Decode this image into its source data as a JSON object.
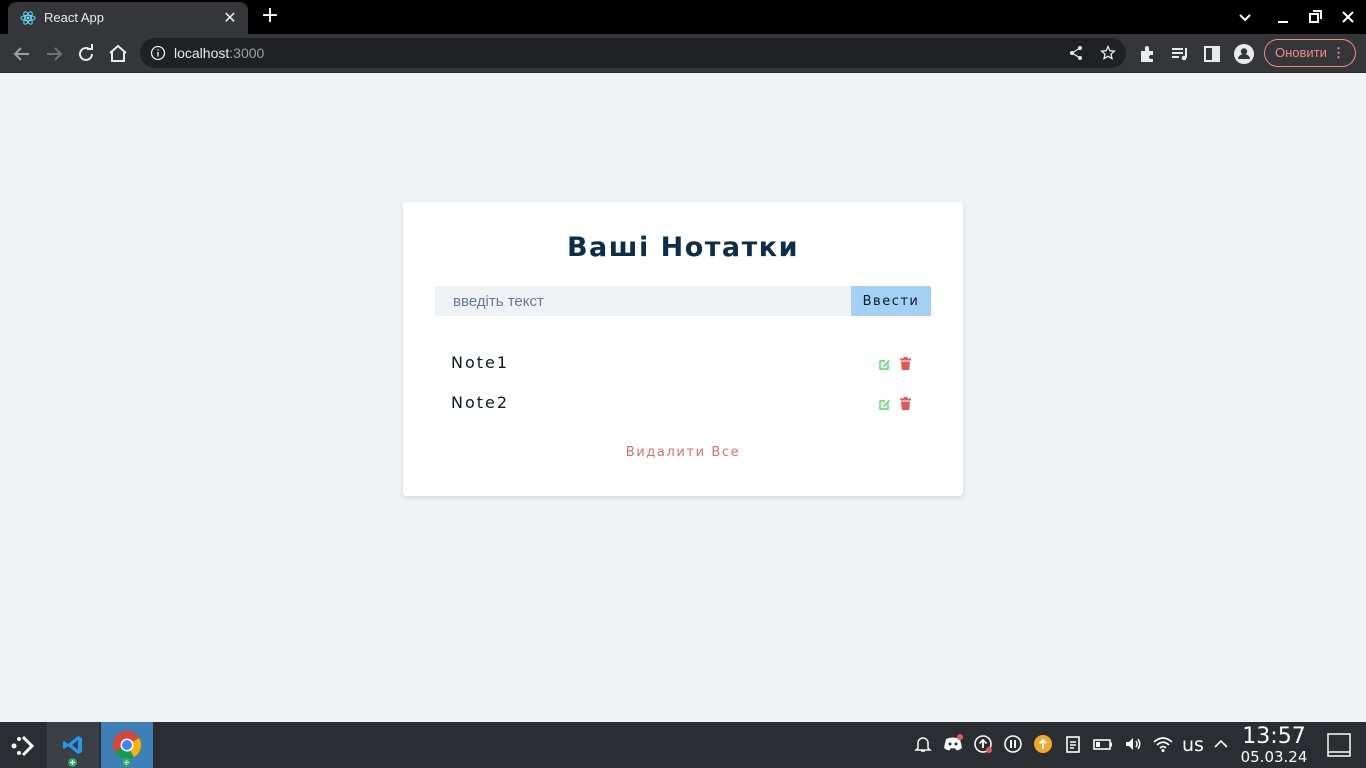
{
  "browser": {
    "tab_title": "React App",
    "tab_favicon": "react-logo-icon",
    "url_host": "localhost",
    "url_port": ":3000",
    "update_button_label": "Оновити"
  },
  "page": {
    "heading": "Ваші Нотатки",
    "input_placeholder": "введіть текст",
    "input_value": "",
    "submit_label": "Ввести",
    "notes": [
      {
        "text": "Note1"
      },
      {
        "text": "Note2"
      }
    ],
    "clear_all_label": "Видалити Все",
    "colors": {
      "heading": "#0b2e4a",
      "submit_bg": "#a3d1f5",
      "edit_icon": "#4cd964",
      "delete_icon": "#e05a5a",
      "clear_all": "#d9706a"
    }
  },
  "taskbar": {
    "apps": [
      "vscode-icon",
      "chrome-icon"
    ],
    "language": "us",
    "time": "13:57",
    "date": "05.03.24"
  }
}
